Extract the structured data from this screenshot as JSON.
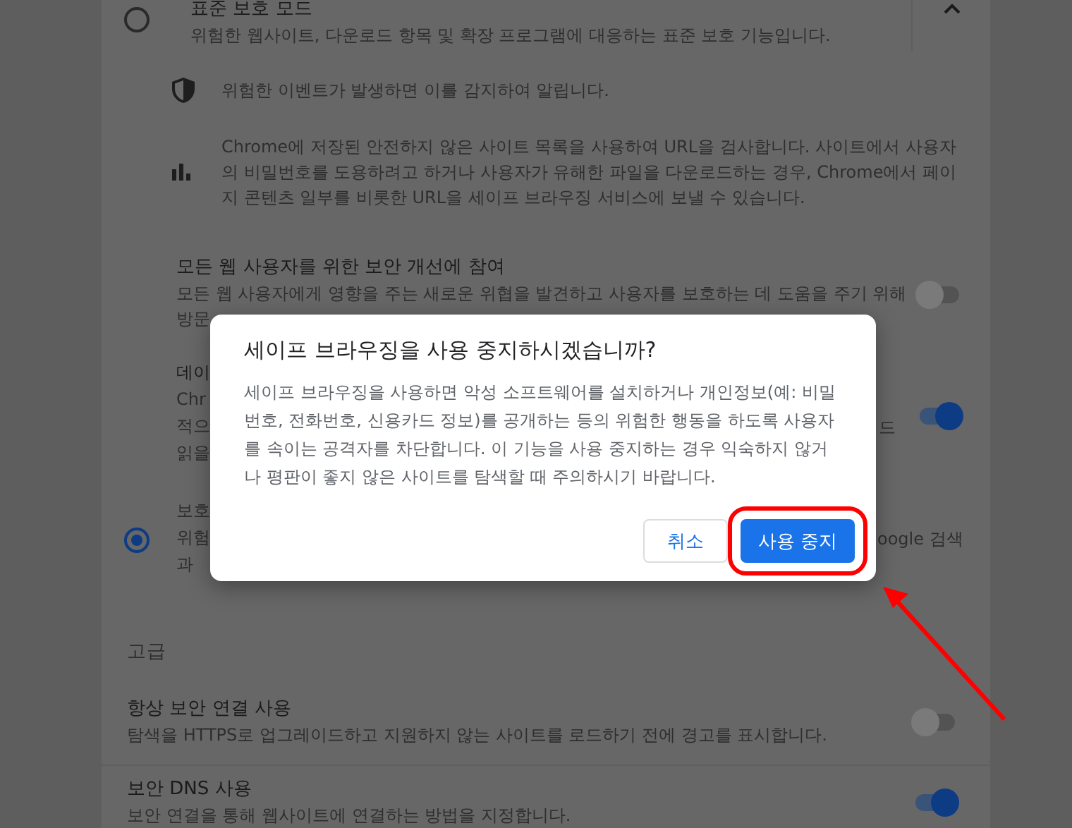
{
  "standard_mode": {
    "title": "표준 보호 모드",
    "description": "위험한 웹사이트, 다운로드 항목 및 확장 프로그램에 대응하는 표준 보호 기능입니다.",
    "selected": false,
    "expanded": true,
    "details": [
      {
        "kind": "shield",
        "text": "위험한 이벤트가 발생하면 이를 감지하여 알립니다."
      },
      {
        "kind": "bars",
        "text": "Chrome에 저장된 안전하지 않은 사이트 목록을 사용하여 URL을 검사합니다. 사이트에서 사용자의 비밀번호를 도용하려고 하거나 사용자가 유해한 파일을 다운로드하는 경우, Chrome에서 페이지 콘텐츠 일부를 비롯한 URL을 세이프 브라우징 서비스에 보낼 수 있습니다."
      }
    ]
  },
  "improve_security": {
    "title": "모든 웹 사용자를 위한 보안 개선에 참여",
    "description": "모든 웹 사용자에게 영향을 주는 새로운 위협을 발견하고 사용자를 보호하는 데 도움을 주기 위해",
    "description_2": "방문",
    "on": false
  },
  "data_row": {
    "lines": [
      "데이",
      "Chr",
      "적으",
      "읽을"
    ],
    "right_fragment": "드",
    "on": true
  },
  "enhanced_mode": {
    "lines": [
      "보호",
      "위험",
      "과"
    ],
    "right_fragment": "oogle 검색",
    "selected": true
  },
  "advanced": {
    "heading": "고급",
    "items": [
      {
        "title": "항상 보안 연결 사용",
        "description": "탐색을 HTTPS로 업그레이드하고 지원하지 않는 사이트를 로드하기 전에 경고를 표시합니다.",
        "on": false
      },
      {
        "title": "보안 DNS 사용",
        "description": "보안 연결을 통해 웹사이트에 연결하는 방법을 지정합니다.",
        "on": true
      }
    ]
  },
  "dialog": {
    "title": "세이프 브라우징을 사용 중지하시겠습니까?",
    "body": "세이프 브라우징을 사용하면 악성 소프트웨어를 설치하거나 개인정보(예: 비밀번호, 전화번호, 신용카드 정보)를 공개하는 등의 위험한 행동을 하도록 사용자를 속이는 공격자를 차단합니다. 이 기능을 사용 중지하는 경우 익숙하지 않거나 평판이 좋지 않은 사이트를 탐색할 때 주의하시기 바랍니다.",
    "buttons": [
      {
        "label": "취소",
        "kind": "secondary",
        "highlighted": false
      },
      {
        "label": "사용 중지",
        "kind": "primary",
        "highlighted": true
      }
    ]
  },
  "annotation": {
    "arrow": true
  }
}
